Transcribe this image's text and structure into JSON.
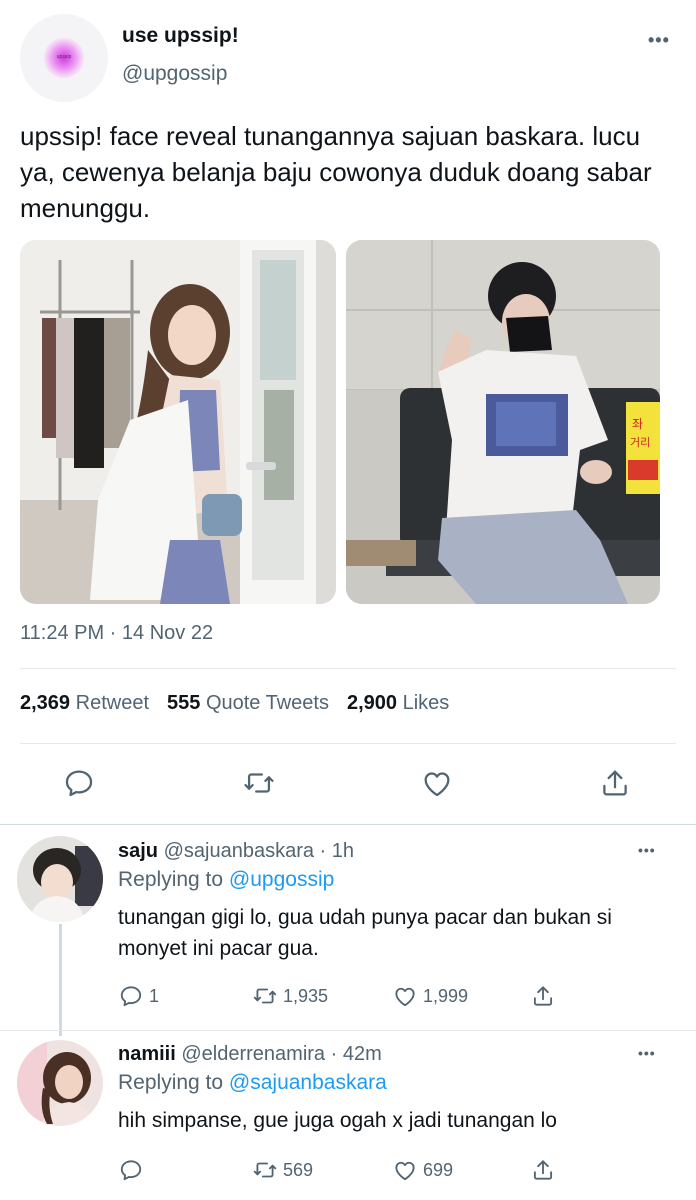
{
  "main_tweet": {
    "name": "use upssip!",
    "handle": "@upgossip",
    "avatar_text": "upssip",
    "text": "upssip! face reveal tunangannya sajuan baskara. lucu ya, cewenya belanja baju cowonya duduk doang sabar menunggu.",
    "timestamp": "11:24 PM · 14 Nov 22",
    "stats": {
      "retweets_count": "2,369",
      "retweets_label": "Retweet",
      "quotes_count": "555",
      "quotes_label": "Quote Tweets",
      "likes_count": "2,900",
      "likes_label": "Likes"
    },
    "photo2_sign": "Za-\n거리"
  },
  "replies": [
    {
      "name": "saju",
      "handle": "@sajuanbaskara · 1h",
      "replying_prefix": "Replying to",
      "replying_to": "@upgossip",
      "text": "tunangan gigi lo, gua udah punya pacar dan bukan si monyet ini pacar gua.",
      "reply_count": "1",
      "retweet_count": "1,935",
      "like_count": "1,999"
    },
    {
      "name": "namiii",
      "handle": "@elderrenamira · 42m",
      "replying_prefix": "Replying to",
      "replying_to": "@sajuanbaskara",
      "text": "hih simpanse, gue juga ogah x jadi tunangan lo",
      "reply_count": "",
      "retweet_count": "569",
      "like_count": "699"
    }
  ],
  "colors": {
    "accent": "#1d9bf0",
    "secondary_text": "#536471",
    "divider": "#e6e9eb"
  },
  "icons": [
    "more-icon",
    "reply-icon",
    "retweet-icon",
    "like-icon",
    "share-icon"
  ]
}
